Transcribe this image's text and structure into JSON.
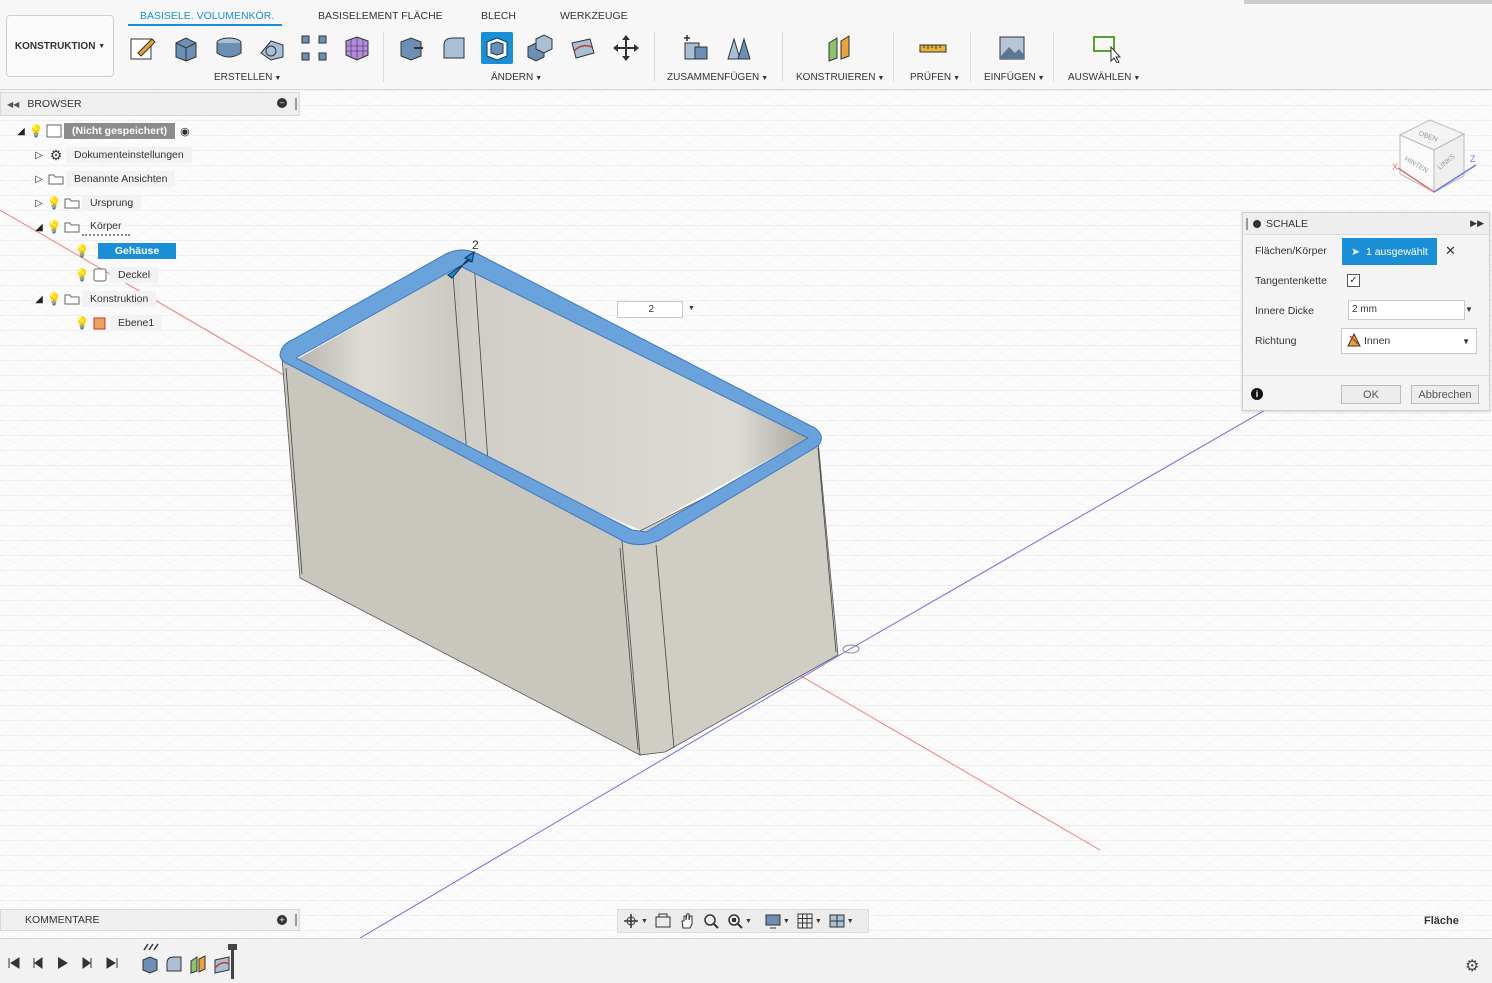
{
  "toolbar": {
    "workspace": "KONSTRUKTION",
    "tabs": [
      "BASISELE. VOLUMENKÖR.",
      "BASISELEMENT FLÄCHE",
      "BLECH",
      "WERKZEUGE"
    ],
    "groups": [
      "ERSTELLEN",
      "ÄNDERN",
      "ZUSAMMENFÜGEN",
      "KONSTRUIEREN",
      "PRÜFEN",
      "EINFÜGEN",
      "AUSWÄHLEN"
    ]
  },
  "browser": {
    "title": "BROWSER",
    "root_label": "(Nicht gespeichert)",
    "items": [
      {
        "label": "Dokumenteinstellungen"
      },
      {
        "label": "Benannte Ansichten"
      },
      {
        "label": "Ursprung"
      },
      {
        "label": "Körper"
      },
      {
        "label": "Gehäuse"
      },
      {
        "label": "Deckel"
      },
      {
        "label": "Konstruktion"
      },
      {
        "label": "Ebene1"
      }
    ]
  },
  "viewcube": {
    "faces": [
      "HINTEN",
      "LINKS",
      "OBEN"
    ],
    "axes": {
      "x": "X",
      "z": "Z"
    }
  },
  "dialog": {
    "title": "SCHALE",
    "faces_label": "Flächen/Körper",
    "selection": "1 ausgewählt",
    "tangent_label": "Tangentenkette",
    "tangent_checked": "✓",
    "thickness_label": "Innere Dicke",
    "thickness_value": "2 mm",
    "direction_label": "Richtung",
    "direction_value": "Innen",
    "ok": "OK",
    "cancel": "Abbrechen"
  },
  "canvas": {
    "dim_value": "2",
    "dim_marker": "2"
  },
  "comments": {
    "title": "KOMMENTARE"
  },
  "status": {
    "text": "Fläche"
  },
  "colors": {
    "accent": "#1b8fd6",
    "body": "#cbc9c0",
    "inner": "#d5d4cc",
    "rim": "#6aa2dc"
  }
}
